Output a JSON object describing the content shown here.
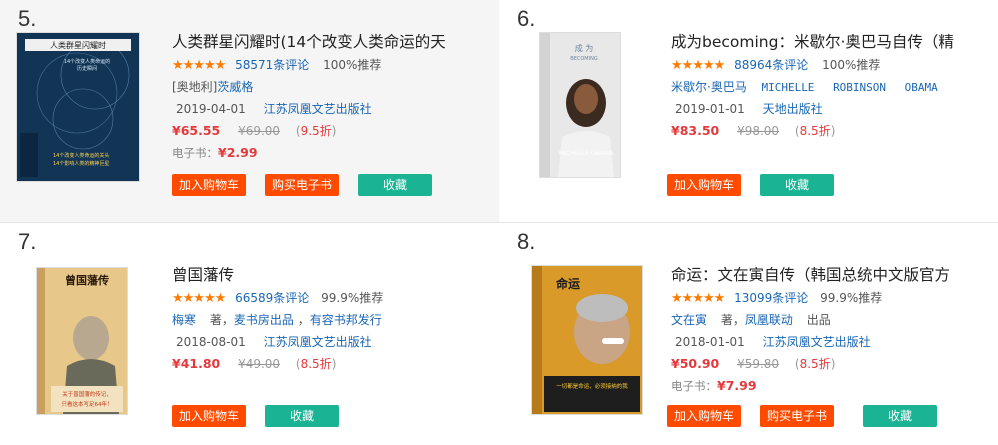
{
  "books": [
    {
      "rank": "5.",
      "title": "人类群星闪耀时(14个改变人类命运的天",
      "reviews": "58571条评论",
      "recommend": "100%推荐",
      "author_line": [
        "[奥地利]",
        "茨威格"
      ],
      "date": "2019-04-01",
      "publisher": "江苏凤凰文艺出版社",
      "price": "¥65.55",
      "old_price": "¥69.00",
      "discount": "9.5折",
      "ebook_label": "电子书：",
      "ebook_price": "¥2.99",
      "buttons": [
        "加入购物车",
        "购买电子书",
        "收藏"
      ],
      "cover_title": "人类群星闪耀时",
      "cover_lines": [
        "14个改变人类命运的",
        "历史瞬间"
      ],
      "cover_bottom": [
        "14个改变人类命运的关头",
        "14个影响人类的精神巨星"
      ]
    },
    {
      "rank": "6.",
      "title": "成为becoming：米歇尔·奥巴马自传（精",
      "reviews": "88964条评论",
      "recommend": "100%推荐",
      "author_line": [
        "米歇尔·奥巴马",
        "MICHELLE",
        "ROBINSON",
        "OBAMA"
      ],
      "date": "2019-01-01",
      "publisher": "天地出版社",
      "price": "¥83.50",
      "old_price": "¥98.00",
      "discount": "8.5折",
      "buttons": [
        "加入购物车",
        "收藏"
      ],
      "cover_title": "成 为",
      "cover_sub": "BECOMING",
      "cover_name": "MICHELLE OBAMA"
    },
    {
      "rank": "7.",
      "title": "曾国藩传",
      "reviews": "66589条评论",
      "recommend": "99.9%推荐",
      "author_line": [
        "梅寒",
        "著，",
        "麦书房出品",
        "，",
        "有容书邦发行"
      ],
      "date": "2018-08-01",
      "publisher": "江苏凤凰文艺出版社",
      "price": "¥41.80",
      "old_price": "¥49.00",
      "discount": "8.5折",
      "buttons": [
        "加入购物车",
        "收藏"
      ],
      "cover_title": "曾国藩传",
      "cover_bottom": [
        "关于曾国藩的传记，",
        "只看这本写足64年！"
      ]
    },
    {
      "rank": "8.",
      "title": "命运：文在寅自传（韩国总统中文版官方",
      "reviews": "13099条评论",
      "recommend": "99.9%推荐",
      "author_line": [
        "文在寅",
        "著，",
        "凤凰联动",
        "出品"
      ],
      "date": "2018-01-01",
      "publisher": "江苏凤凰文艺出版社",
      "price": "¥50.90",
      "old_price": "¥59.80",
      "discount": "8.5折",
      "ebook_label": "电子书：",
      "ebook_price": "¥7.99",
      "buttons": [
        "加入购物车",
        "购买电子书",
        "收藏"
      ],
      "cover_title": "命运",
      "cover_side": "文在寅自传",
      "cover_bottom": [
        "一切都是命运，必须接纳的我"
      ]
    }
  ],
  "colors": {
    "accent_red": "#ff4b00",
    "green": "#1ab394",
    "star": "#ff7a00",
    "link": "#1a66b3",
    "price": "#e4393c"
  }
}
